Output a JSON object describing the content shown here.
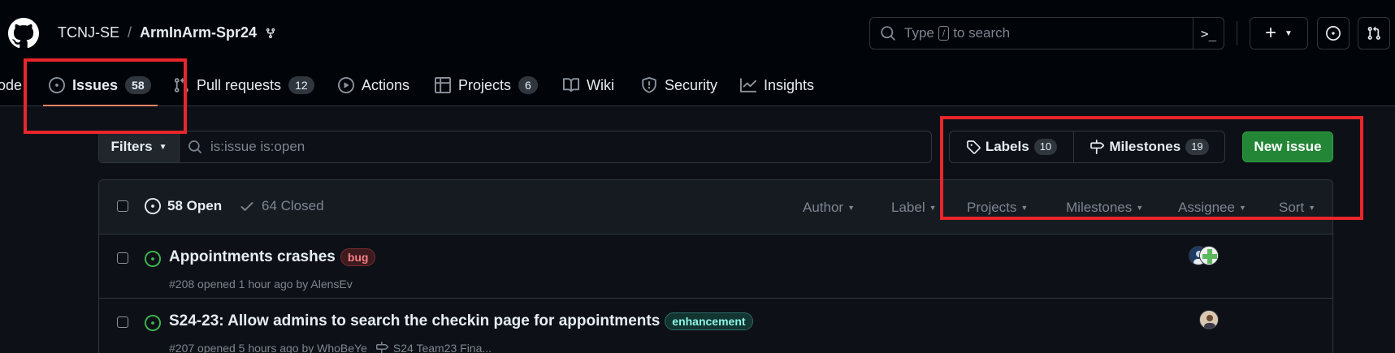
{
  "header": {
    "owner": "TCNJ-SE",
    "separator": "/",
    "repo": "ArmInArm-Spr24",
    "search": {
      "prefix": "Type",
      "key": "/",
      "suffix": "to search"
    },
    "command_glyph": ">_"
  },
  "tabs": [
    {
      "label": "Code"
    },
    {
      "label": "Issues",
      "count": "58"
    },
    {
      "label": "Pull requests",
      "count": "12"
    },
    {
      "label": "Actions"
    },
    {
      "label": "Projects",
      "count": "6"
    },
    {
      "label": "Wiki"
    },
    {
      "label": "Security"
    },
    {
      "label": "Insights"
    }
  ],
  "filter": {
    "button_label": "Filters",
    "query": "is:issue is:open"
  },
  "labels_button": {
    "label": "Labels",
    "count": "10"
  },
  "milestones_button": {
    "label": "Milestones",
    "count": "19"
  },
  "new_issue_label": "New issue",
  "list_header": {
    "open_label": "58 Open",
    "closed_label": "64 Closed",
    "filters": [
      "Author",
      "Label",
      "Projects",
      "Milestones",
      "Assignee",
      "Sort"
    ]
  },
  "issues": [
    {
      "title": "Appointments crashes",
      "label": "bug",
      "meta": "#208 opened 1 hour ago by AlensEv"
    },
    {
      "title": "S24-23: Allow admins to search the checkin page for appointments",
      "label": "enhancement",
      "meta": "#207 opened 5 hours ago by WhoBeYe",
      "milestone": "S24 Team23 Fina..."
    }
  ],
  "colors": {
    "accent_underline": "#f78166",
    "new_issue_bg": "#238636",
    "open_icon": "#3fb950",
    "annotation_red": "#e8262b"
  }
}
